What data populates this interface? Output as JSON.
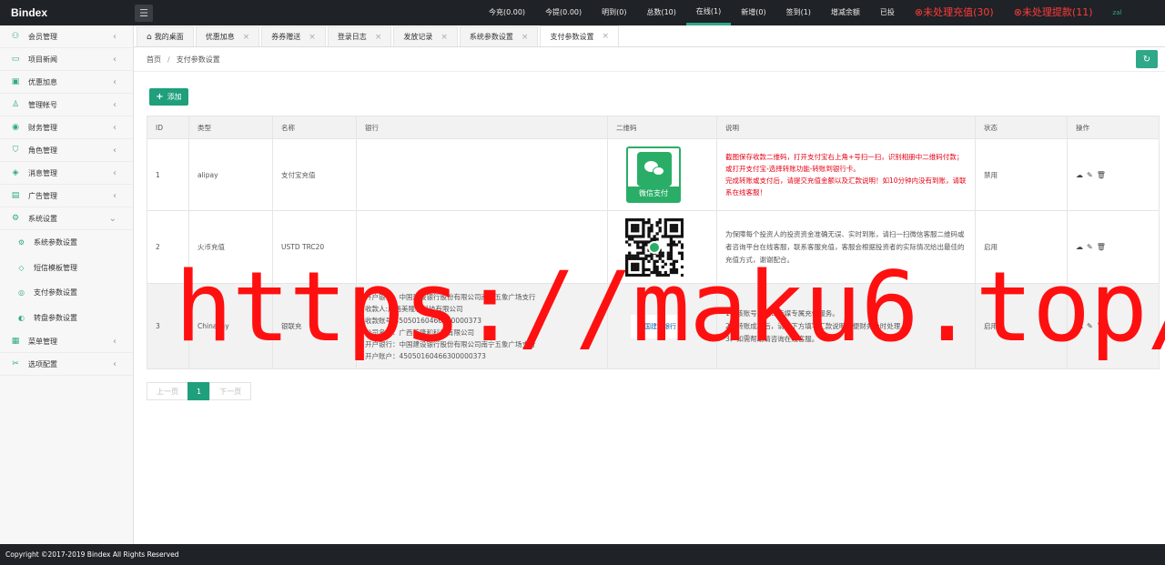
{
  "brand": "Bindex",
  "top_stats": [
    {
      "label": "今充(0.00)",
      "active": false,
      "alert": false
    },
    {
      "label": "今提(0.00)",
      "active": false,
      "alert": false
    },
    {
      "label": "明到(0)",
      "active": false,
      "alert": false
    },
    {
      "label": "总数(10)",
      "active": false,
      "alert": false
    },
    {
      "label": "在线(1)",
      "active": true,
      "alert": false
    },
    {
      "label": "新增(0)",
      "active": false,
      "alert": false
    },
    {
      "label": "签到(1)",
      "active": false,
      "alert": false
    },
    {
      "label": "增减余额",
      "active": false,
      "alert": false
    },
    {
      "label": "已投",
      "active": false,
      "alert": false
    },
    {
      "label": "⊗未处理充值(30)",
      "active": false,
      "alert": true
    },
    {
      "label": "⊗未处理提款(11)",
      "active": false,
      "alert": true
    },
    {
      "label": "zal",
      "active": false,
      "alert": false,
      "user": true
    }
  ],
  "sidebar": {
    "items": [
      {
        "label": "会员管理",
        "icon": "user-icon",
        "glyph": "⚇"
      },
      {
        "label": "项目新闻",
        "icon": "book-icon",
        "glyph": "▭"
      },
      {
        "label": "优惠加息",
        "icon": "wallet-icon",
        "glyph": "▣"
      },
      {
        "label": "管理帐号",
        "icon": "admin-icon",
        "glyph": "♙"
      },
      {
        "label": "财务管理",
        "icon": "finance-icon",
        "glyph": "◉"
      },
      {
        "label": "角色管理",
        "icon": "shield-icon",
        "glyph": "⛉"
      },
      {
        "label": "消息管理",
        "icon": "message-icon",
        "glyph": "◈"
      },
      {
        "label": "广告管理",
        "icon": "image-icon",
        "glyph": "▤"
      },
      {
        "label": "系统设置",
        "icon": "gear-icon",
        "glyph": "⚙",
        "expanded": true
      }
    ],
    "sub_items": [
      {
        "label": "系统参数设置",
        "icon": "gear-small-icon",
        "glyph": "⚙"
      },
      {
        "label": "短信模板管理",
        "icon": "tag-icon",
        "glyph": "◇"
      },
      {
        "label": "支付参数设置",
        "icon": "pay-icon",
        "glyph": "◎"
      },
      {
        "label": "转盘参数设置",
        "icon": "wheel-icon",
        "glyph": "◐"
      }
    ],
    "bottom_items": [
      {
        "label": "菜单管理",
        "icon": "menu-icon",
        "glyph": "▦"
      },
      {
        "label": "选项配置",
        "icon": "options-icon",
        "glyph": "✂"
      }
    ]
  },
  "tabs": [
    {
      "label": "我的桌面",
      "home": true,
      "closable": false,
      "active": false
    },
    {
      "label": "优惠加息",
      "closable": true,
      "active": false
    },
    {
      "label": "券券赠送",
      "closable": true,
      "active": false
    },
    {
      "label": "登录日志",
      "closable": true,
      "active": false
    },
    {
      "label": "发放记录",
      "closable": true,
      "active": false
    },
    {
      "label": "系统参数设置",
      "closable": true,
      "active": false
    },
    {
      "label": "支付参数设置",
      "closable": true,
      "active": true
    }
  ],
  "breadcrumb": {
    "home": "首页",
    "separator": "/",
    "current": "支付参数设置"
  },
  "toolbar": {
    "add_label": "添加",
    "add_icon": "+",
    "refresh_icon": "↻"
  },
  "table": {
    "headers": [
      "ID",
      "类型",
      "名称",
      "银行",
      "二维码",
      "说明",
      "状态",
      "操作"
    ],
    "rows": [
      {
        "id": "1",
        "type": "alipay",
        "name": "支付宝充值",
        "bank": [],
        "qr": "wechat-pay-icon",
        "qr_label": "微信支付",
        "desc": "截图保存收款二维码，打开支付宝右上角+号扫一扫，识别相册中二维码付款；或打开支付宝-选择转账功能-转账到银行卡。\n完成转账或支付后，请提交充值金额以及汇款说明！如10分钟内没有到账，请联系在线客服！",
        "desc_red": true,
        "status": "禁用"
      },
      {
        "id": "2",
        "type": "火币充值",
        "name": "USTD TRC20",
        "bank": [],
        "qr": "qr-code-icon",
        "qr_label": "",
        "desc": "为保障每个投资人的投资资金准确无误、实时到账，请扫一扫微信客服二维码或者咨询平台在线客服，联系客服充值，客服会根据投资者的实际情况给出最佳的充值方式，谢谢配合。",
        "desc_red": false,
        "status": "启用"
      },
      {
        "id": "3",
        "type": "ChinaPay",
        "name": "银联充",
        "bank": [
          "开户银行：中国建设银行股份有限公司南宁五象广场支行",
          "收款人:广西美隆和科技有限公司",
          "收款账号:45050160466300000373",
          "公司名称：广西美隆和科技有限公司",
          "开户银行：中国建设银行股份有限公司南宁五象广场支行",
          "开户账户：45050160466300000373"
        ],
        "qr": "bank-logo-icon",
        "qr_label": "中国建设银行",
        "desc": "1、该账号为我司传媒专属充值服务。\n2、转账成功后，请在下方填写汇款说明，便财务及时处理。\n3、如需帮助请咨询在线客服。",
        "desc_red": false,
        "status": "启用"
      }
    ],
    "op_icons": [
      "cloud-icon",
      "edit-icon",
      "delete-icon"
    ]
  },
  "pager": {
    "prev": "上一页",
    "current": "1",
    "next": "下一页"
  },
  "watermark": "https://maku6.top/",
  "footer": "Copyright ©2017-2019 Bindex All Rights Reserved",
  "colors": {
    "accent": "#1f9f7c",
    "topbar": "#1f2226",
    "alert": "#ff3b3b",
    "watermark": "#ff1010"
  }
}
